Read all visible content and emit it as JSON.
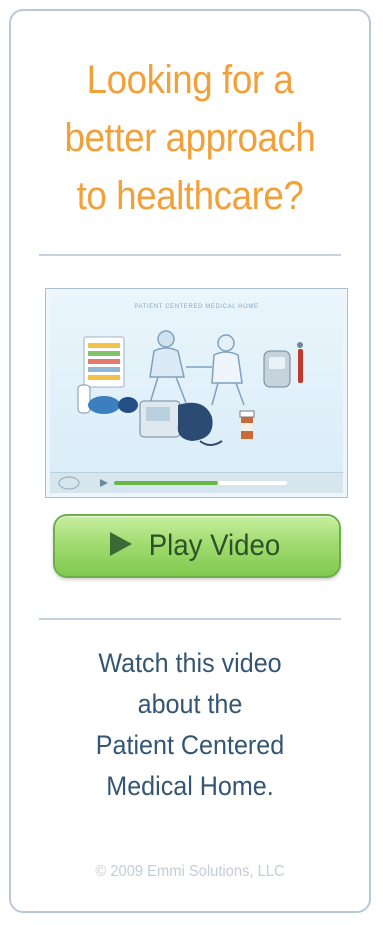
{
  "headline": {
    "line1": "Looking for a",
    "line2": "better approach",
    "line3": "to healthcare?"
  },
  "video": {
    "caption": "PATIENT CENTERED MEDICAL HOME",
    "progress": 0.6,
    "thumbnail_icons": [
      "health-chart-icon",
      "doctor-patient-icon",
      "glucose-meter-icon",
      "blood-pressure-monitor-icon",
      "pill-bottle-icon",
      "inhaler-icon"
    ]
  },
  "play_button": {
    "label": "Play Video",
    "icon": "play-icon"
  },
  "description": {
    "line1": "Watch this video",
    "line2": "about the",
    "line3": "Patient Centered",
    "line4": "Medical Home."
  },
  "footer": {
    "copyright": "© 2009 Emmi Solutions, LLC"
  },
  "colors": {
    "headline": "#f2a13a",
    "description": "#355673",
    "button_green": "#8fd05c",
    "border": "#b9c8d8"
  }
}
